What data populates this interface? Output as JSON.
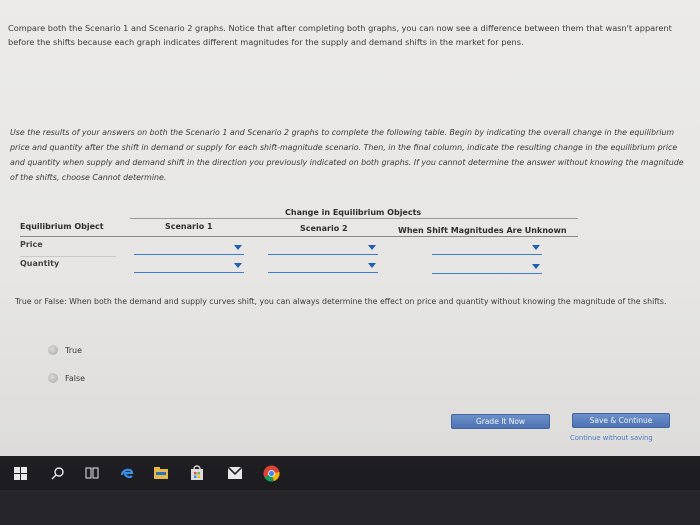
{
  "intro_text": "Compare both the Scenario 1 and Scenario 2 graphs. Notice that after completing both graphs, you can now see a difference between them that wasn't apparent before the shifts because each graph indicates different magnitudes for the supply and demand shifts in the market for pens.",
  "instructions_text": "Use the results of your answers on both the Scenario 1 and Scenario 2 graphs to complete the following table. Begin by indicating the overall change in the equilibrium price and quantity after the shift in demand or supply for each shift-magnitude scenario. Then, in the final column, indicate the resulting change in the equilibrium price and quantity when supply and demand shift in the direction you previously indicated on both graphs. If you cannot determine the answer without knowing the magnitude of the shifts, choose Cannot determine.",
  "table": {
    "group_header": "Change in Equilibrium Objects",
    "col_object": "Equilibrium Object",
    "col_s1": "Scenario 1",
    "col_s2": "Scenario 2",
    "col_unknown": "When Shift Magnitudes Are Unknown",
    "rows": [
      {
        "label": "Price"
      },
      {
        "label": "Quantity"
      }
    ]
  },
  "question": {
    "text": "True or False: When both the demand and supply curves shift, you can always determine the effect on price and quantity without knowing the magnitude of the shifts.",
    "options": [
      "True",
      "False"
    ]
  },
  "buttons": {
    "grade": "Grade It Now",
    "save": "Save & Continue",
    "continue_link": "Continue without saving"
  },
  "taskbar": {
    "icons": [
      "windows-start-icon",
      "search-icon",
      "task-view-icon",
      "edge-icon",
      "file-explorer-icon",
      "store-icon",
      "mail-icon",
      "chrome-icon"
    ]
  },
  "colors": {
    "button_blue": "#5a7fbf",
    "dropdown_blue": "#1f5fb8",
    "taskbar": "#1e1d22"
  }
}
